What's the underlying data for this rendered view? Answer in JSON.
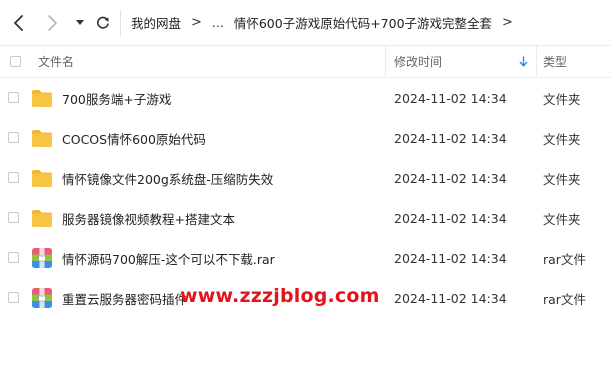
{
  "breadcrumb": {
    "root": "我的网盘",
    "ellipsis": "...",
    "current": "情怀600子游戏原始代码+700子游戏完整全套"
  },
  "columns": {
    "name": "文件名",
    "mtime": "修改时间",
    "type": "类型"
  },
  "files": [
    {
      "name": "700服务端+子游戏",
      "mtime": "2024-11-02 14:34",
      "type": "文件夹",
      "icon": "folder-icon"
    },
    {
      "name": "COCOS情怀600原始代码",
      "mtime": "2024-11-02 14:34",
      "type": "文件夹",
      "icon": "folder-icon"
    },
    {
      "name": "情怀镜像文件200g系统盘-压缩防失效",
      "mtime": "2024-11-02 14:34",
      "type": "文件夹",
      "icon": "folder-icon"
    },
    {
      "name": "服务器镜像视频教程+搭建文本",
      "mtime": "2024-11-02 14:34",
      "type": "文件夹",
      "icon": "folder-icon"
    },
    {
      "name": "情怀源码700解压-这个可以不下载.rar",
      "mtime": "2024-11-02 14:34",
      "type": "rar文件",
      "icon": "rar-archive-icon"
    },
    {
      "name": "重置云服务器密码插件",
      "mtime": "2024-11-02 14:34",
      "type": "rar文件",
      "icon": "rar-archive-icon"
    }
  ],
  "watermark": "www.zzzjblog.com",
  "colors": {
    "folder": "#f7c543",
    "sort_arrow": "#2e86f0",
    "watermark": "#e8121b"
  }
}
